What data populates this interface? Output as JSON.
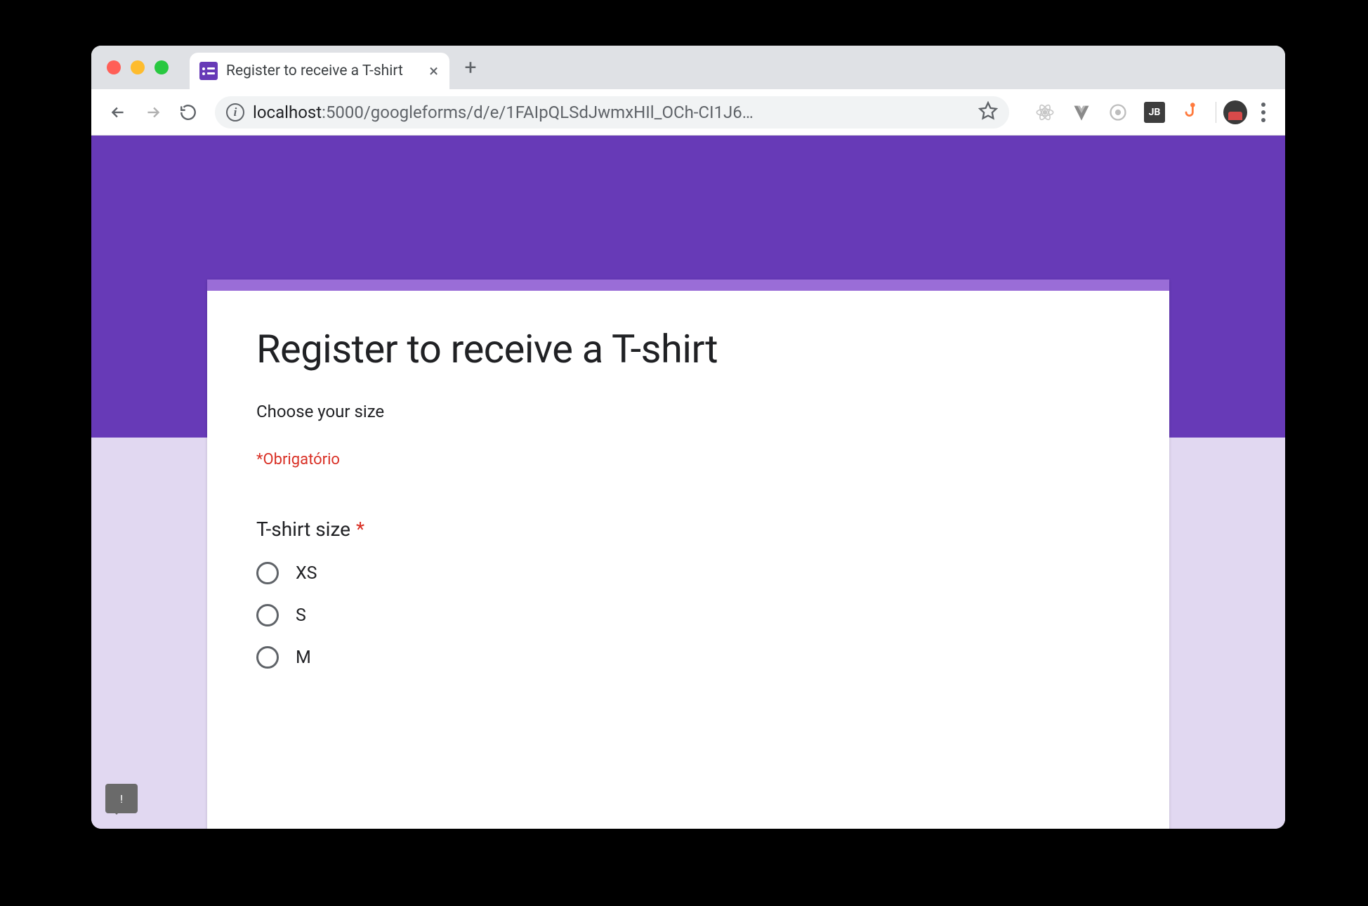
{
  "browser": {
    "tab_title": "Register to receive a T-shirt",
    "url_host": "localhost",
    "url_path": ":5000/googleforms/d/e/1FAIpQLSdJwmxHIl_OCh-CI1J6…",
    "extensions": {
      "jb_label": "JB"
    }
  },
  "form": {
    "title": "Register to receive a T-shirt",
    "description": "Choose your size",
    "required_note": "*Obrigatório",
    "question": {
      "title": "T-shirt size",
      "required_marker": "*",
      "options": [
        "XS",
        "S",
        "M"
      ]
    }
  },
  "feedback": {
    "glyph": "!"
  },
  "colors": {
    "theme_primary": "#673ab7",
    "theme_accent": "#9a6dd7",
    "theme_light": "#e1d8f1",
    "required_red": "#d93025"
  }
}
